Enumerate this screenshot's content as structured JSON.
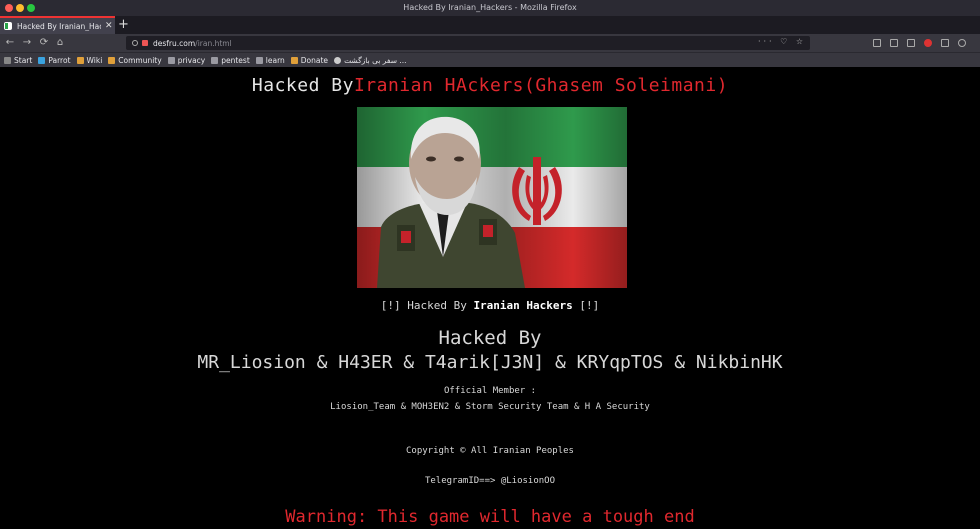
{
  "window": {
    "title": "Hacked By Iranian_Hackers - Mozilla Firefox"
  },
  "tab": {
    "title": "Hacked By Iranian_Hacke",
    "close": "✕",
    "new": "+"
  },
  "nav": {
    "back": "←",
    "forward": "→",
    "reload": "⟳",
    "home": "⌂"
  },
  "url": {
    "domain": "desfru.com",
    "path": "/iran.html",
    "actions": "··· ♡ ☆"
  },
  "bookmarks": [
    {
      "label": "Start",
      "color": "#888888"
    },
    {
      "label": "Parrot",
      "color": "#3aa3e0"
    },
    {
      "label": "Wiki",
      "color": "#e0a03a"
    },
    {
      "label": "Community",
      "color": "#e0a03a"
    },
    {
      "label": "privacy",
      "color": "#9a9aa2"
    },
    {
      "label": "pentest",
      "color": "#9a9aa2"
    },
    {
      "label": "learn",
      "color": "#9a9aa2"
    },
    {
      "label": "Donate",
      "color": "#e0a03a"
    },
    {
      "label": "سفر بی بازگشت ...",
      "color": "#cccccc"
    }
  ],
  "page": {
    "heading_white": "Hacked By",
    "heading_red": "Iranian HAckers(Ghasem Soleimani)",
    "line_hacked_by_prefix": "[!] Hacked By ",
    "line_hacked_by_name": "Iranian Hackers",
    "line_hacked_by_suffix": " [!]",
    "hacked_by_title": "Hacked By",
    "members": "MR_Liosion & H43ER & T4arik[J3N] & KRYqpTOS & NikbinHK",
    "official_label": "Official Member :",
    "teams": "Liosion_Team & MOH3EN2 & Storm Security Team & H A Security",
    "copyright": "Copyright © All Iranian Peoples",
    "telegram": "TelegramID==> @LiosionOO",
    "warning": "Warning: This game will have a tough end"
  },
  "colors": {
    "accent_red": "#e0282e",
    "flag_green": "#2aa34a",
    "flag_red": "#d42a2a"
  }
}
